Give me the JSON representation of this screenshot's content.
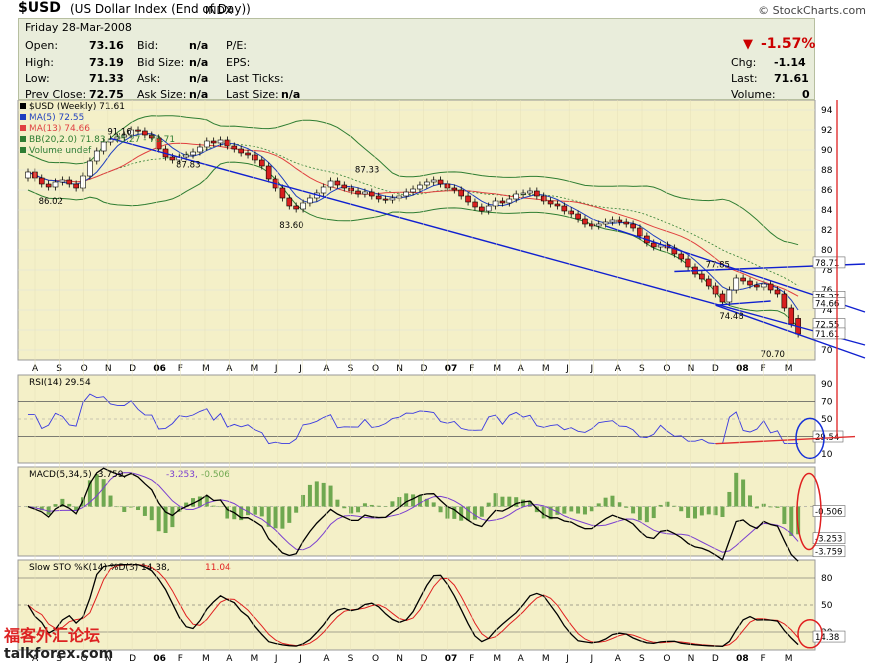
{
  "header": {
    "symbol": "$USD",
    "name": "(US Dollar Index (End of Day))",
    "exchange": "INDX",
    "brand": "© StockCharts.com"
  },
  "quote": {
    "date": "Friday   28-Mar-2008",
    "open_label": "Open:",
    "open": "73.16",
    "high_label": "High:",
    "high": "73.19",
    "low_label": "Low:",
    "low": "71.33",
    "prev_label": "Prev Close:",
    "prev": "72.75",
    "bid_label": "Bid:",
    "bid": "n/a",
    "bidsize_label": "Bid Size:",
    "bidsize": "n/a",
    "ask_label": "Ask:",
    "ask": "n/a",
    "asksize_label": "Ask Size:",
    "asksize": "n/a",
    "pe_label": "P/E:",
    "eps_label": "EPS:",
    "lastticks_label": "Last Ticks:",
    "lastsize_label": "Last Size:",
    "lastsize": "n/a",
    "pct_change": "-1.57%",
    "chg_label": "Chg:",
    "chg": "-1.14",
    "last_label": "Last:",
    "last": "71.61",
    "vol_label": "Volume:",
    "vol": "0"
  },
  "colors": {
    "panel_bg": "#f4f0c8",
    "candle_up": "#ffffff",
    "candle_down": "#d81f1f",
    "bollinger": "#2e7d32",
    "ma5": "#1f3fbf",
    "ma13": "#e04040",
    "trendline": "#1020d0",
    "rsi": "#3a3ae0",
    "macd": "#000000",
    "macd_signal": "#7a3fd0",
    "hist": "#6fa850"
  },
  "chart_data": [
    {
      "type": "candlestick",
      "panel": "price",
      "legend": [
        "$USD (Weekly) 71.61",
        "MA(5) 72.55",
        "MA(13) 74.66",
        "BB(20,2.0) 71.83 - 75.27 - 78.71",
        "Volume undef"
      ],
      "y_ticks": [
        70,
        72,
        74,
        76,
        78,
        80,
        82,
        84,
        86,
        88,
        90,
        92,
        94
      ],
      "ylim": [
        69,
        95
      ],
      "x_labels": [
        "A",
        "S",
        "O",
        "N",
        "D",
        "06",
        "F",
        "M",
        "A",
        "M",
        "J",
        "J",
        "A",
        "S",
        "O",
        "N",
        "D",
        "07",
        "F",
        "M",
        "A",
        "M",
        "J",
        "J",
        "A",
        "S",
        "O",
        "N",
        "D",
        "08",
        "F",
        "M"
      ],
      "close": [
        87.8,
        87.2,
        86.6,
        86.3,
        86.8,
        87.0,
        86.6,
        86.2,
        87.4,
        88.9,
        89.9,
        90.8,
        91.1,
        91.3,
        91.5,
        92.0,
        91.9,
        91.5,
        91.2,
        90.1,
        89.3,
        89.0,
        89.3,
        89.5,
        89.8,
        90.3,
        90.9,
        90.7,
        91.0,
        90.4,
        90.1,
        89.7,
        89.5,
        89.0,
        88.4,
        87.1,
        86.2,
        85.2,
        84.4,
        84.1,
        84.7,
        85.2,
        85.7,
        86.3,
        86.9,
        86.5,
        86.2,
        85.9,
        85.6,
        85.8,
        85.4,
        85.1,
        85.0,
        85.2,
        85.4,
        85.8,
        86.1,
        86.5,
        86.8,
        87.0,
        86.6,
        86.2,
        86.0,
        85.4,
        84.8,
        84.3,
        83.9,
        84.4,
        84.9,
        84.7,
        85.1,
        85.6,
        85.7,
        85.9,
        85.4,
        84.9,
        84.6,
        84.4,
        83.9,
        83.6,
        83.1,
        82.6,
        82.4,
        82.6,
        82.8,
        83.0,
        82.8,
        82.6,
        82.2,
        81.4,
        80.7,
        80.3,
        80.5,
        80.2,
        79.6,
        79.1,
        78.3,
        77.6,
        77.1,
        76.4,
        75.6,
        74.8,
        76.0,
        77.2,
        76.9,
        76.5,
        76.3,
        76.6,
        76.0,
        75.6,
        74.2,
        72.6,
        71.6
      ],
      "open": [
        87.2,
        87.8,
        87.2,
        86.6,
        86.3,
        86.8,
        87.0,
        86.6,
        86.2,
        87.4,
        88.9,
        89.9,
        90.8,
        91.1,
        91.3,
        91.5,
        92.0,
        91.9,
        91.5,
        91.2,
        90.1,
        89.3,
        89.0,
        89.3,
        89.5,
        89.8,
        90.3,
        90.9,
        90.7,
        91.0,
        90.4,
        90.1,
        89.7,
        89.5,
        89.0,
        88.4,
        87.1,
        86.2,
        85.2,
        84.4,
        84.1,
        84.7,
        85.2,
        85.7,
        86.3,
        86.9,
        86.5,
        86.2,
        85.9,
        85.6,
        85.8,
        85.4,
        85.1,
        85.0,
        85.2,
        85.4,
        85.8,
        86.1,
        86.5,
        86.8,
        87.0,
        86.6,
        86.2,
        86.0,
        85.4,
        84.8,
        84.3,
        83.9,
        84.4,
        84.9,
        84.7,
        85.1,
        85.6,
        85.7,
        85.9,
        85.4,
        84.9,
        84.6,
        84.4,
        83.9,
        83.6,
        83.1,
        82.6,
        82.4,
        82.6,
        82.8,
        83.0,
        82.8,
        82.6,
        82.2,
        81.4,
        80.7,
        80.3,
        80.5,
        80.2,
        79.6,
        79.1,
        78.3,
        77.6,
        77.1,
        76.4,
        75.6,
        74.8,
        76.0,
        77.2,
        76.9,
        76.5,
        76.3,
        76.6,
        76.0,
        75.6,
        74.2,
        73.16
      ],
      "annotations": [
        {
          "label": "86.02",
          "y": 86.02
        },
        {
          "label": "87.83",
          "y": 87.83
        },
        {
          "label": "91.16",
          "y": 91.16
        },
        {
          "label": "83.60",
          "y": 83.6
        },
        {
          "label": "87.33",
          "y": 87.33
        },
        {
          "label": "77.85",
          "y": 77.85
        },
        {
          "label": "74.48",
          "y": 74.48
        },
        {
          "label": "70.70",
          "y": 70.7
        }
      ],
      "right_labels": [
        {
          "label": "78.71",
          "y": 78.71
        },
        {
          "label": "75.27",
          "y": 75.27
        },
        {
          "label": "74.66",
          "y": 74.66
        },
        {
          "label": "72.55",
          "y": 72.55
        },
        {
          "label": "71.61",
          "y": 71.61
        }
      ]
    },
    {
      "type": "line",
      "panel": "rsi",
      "legend": "RSI(14) 29.54",
      "y_ticks": [
        10,
        30,
        50,
        70,
        90
      ],
      "ylim": [
        0,
        100
      ],
      "last_label": "29.54"
    },
    {
      "type": "line",
      "panel": "macd",
      "legend": [
        "MACD(5,34,5) -3.759, -3.253, -0.506"
      ],
      "legend_parts": [
        "MACD(5,34,5)",
        "-3.759",
        "-3.253",
        "-0.506"
      ],
      "right_labels": [
        "-0.506",
        "-3.253",
        "-3.759"
      ]
    },
    {
      "type": "line",
      "panel": "stochastic",
      "legend_parts": [
        "Slow STO %K(14) %D(3)",
        "14.38",
        "11.04"
      ],
      "y_ticks": [
        20,
        50,
        80
      ],
      "ylim": [
        0,
        100
      ],
      "right_labels": [
        "14.38"
      ]
    }
  ],
  "watermark": {
    "line1": "福客外汇论坛",
    "line2": "talkforex.com"
  }
}
